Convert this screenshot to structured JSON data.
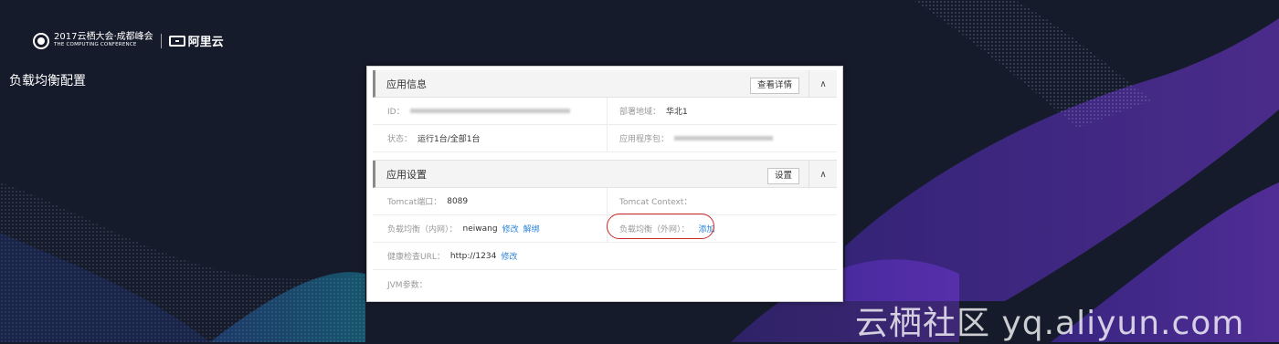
{
  "header": {
    "conference_title": "2017云栖大会·成都峰会",
    "conference_subtitle": "THE COMPUTING CONFERENCE",
    "brand": "阿里云"
  },
  "page_title": "负载均衡配置",
  "app_info": {
    "title": "应用信息",
    "details_button": "查看详情",
    "collapse_icon": "chevron-up-icon",
    "fields": {
      "id_label": "ID：",
      "region_label": "部署地域：",
      "region_value": "华北1",
      "status_label": "状态：",
      "status_value": "运行1台/全部1台",
      "package_label": "应用程序包："
    }
  },
  "app_settings": {
    "title": "应用设置",
    "settings_button": "设置",
    "collapse_icon": "chevron-up-icon",
    "fields": {
      "tomcat_port_label": "Tomcat端口：",
      "tomcat_port_value": "8089",
      "tomcat_context_label": "Tomcat Context：",
      "slb_internal_label": "负载均衡（内网）：",
      "slb_internal_value": "neiwang",
      "slb_internal_edit": "修改",
      "slb_internal_unbind": "解绑",
      "slb_public_label": "负载均衡（外网）：",
      "slb_public_add": "添加",
      "health_check_label": "健康检查URL：",
      "health_check_value": "http://1234",
      "health_check_edit": "修改",
      "jvm_label": "JVM参数："
    }
  },
  "annotation_color": "#cc2a2a",
  "link_color": "#2b84d6",
  "watermark": "云栖社区 yq.aliyun.com"
}
